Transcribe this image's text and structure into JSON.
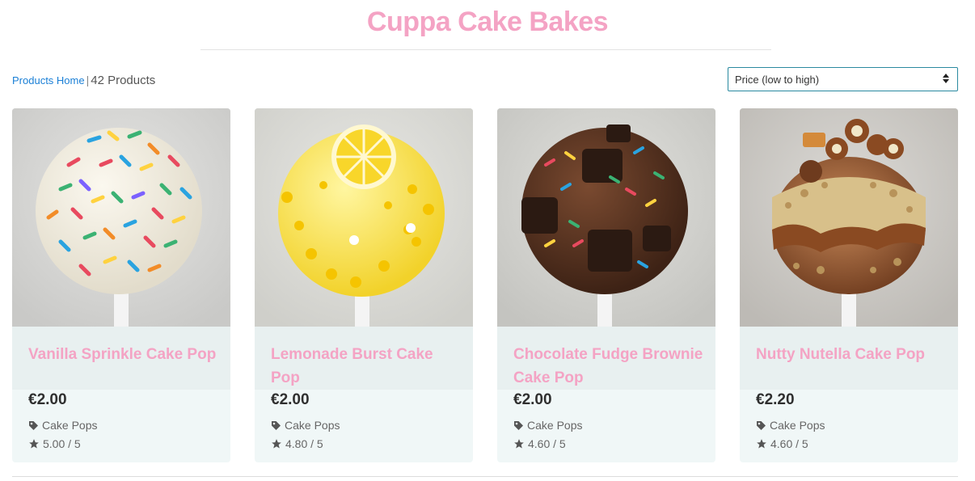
{
  "site": {
    "title": "Cuppa Cake Bakes"
  },
  "breadcrumb": {
    "home_link": "Products Home",
    "separator": "|",
    "count": "42 Products"
  },
  "sort": {
    "selected": "Price (low to high)"
  },
  "products": [
    {
      "name": "Vanilla Sprinkle Cake Pop",
      "price": "€2.00",
      "category": "Cake Pops",
      "rating": "5.00 / 5"
    },
    {
      "name": "Lemonade Burst Cake Pop",
      "price": "€2.00",
      "category": "Cake Pops",
      "rating": "4.80 / 5"
    },
    {
      "name": "Chocolate Fudge Brownie Cake Pop",
      "price": "€2.00",
      "category": "Cake Pops",
      "rating": "4.60 / 5"
    },
    {
      "name": "Nutty Nutella Cake Pop",
      "price": "€2.20",
      "category": "Cake Pops",
      "rating": "4.60 / 5"
    }
  ],
  "colors": {
    "accent": "#f4a3c4",
    "link": "#1a7fd6",
    "card_bg": "#f0f7f7",
    "select_border": "#2a8aa0"
  },
  "icons": [
    "tag-icon",
    "star-icon",
    "sort-arrows-icon"
  ]
}
